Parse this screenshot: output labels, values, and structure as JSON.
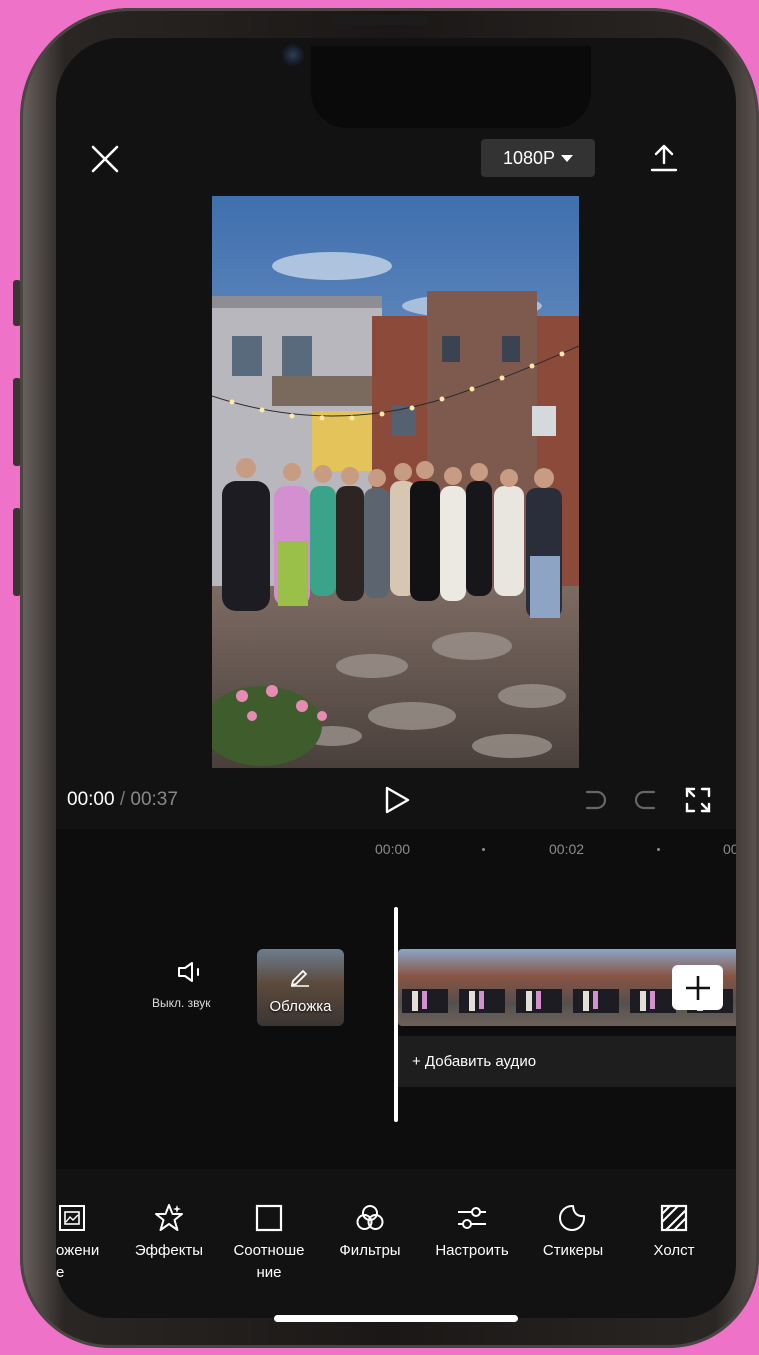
{
  "header": {
    "resolution_label": "1080P"
  },
  "player": {
    "current_time": "00:00",
    "separator": "/",
    "total_time": "00:37"
  },
  "ruler": {
    "marks": [
      "00:00",
      "00:02",
      "00"
    ]
  },
  "tracks": {
    "mute_label": "Выкл. звук",
    "cover_label": "Обложка",
    "add_audio_label": "+ Добавить аудио"
  },
  "toolbar": {
    "items": [
      {
        "label": "ожени\nе",
        "icon": "image-overlay-icon"
      },
      {
        "label": "Эффекты",
        "icon": "effects-star-icon"
      },
      {
        "label": "Соотноше\nние",
        "icon": "aspect-ratio-icon"
      },
      {
        "label": "Фильтры",
        "icon": "filters-icon"
      },
      {
        "label": "Настроить",
        "icon": "adjust-sliders-icon"
      },
      {
        "label": "Стикеры",
        "icon": "stickers-icon"
      },
      {
        "label": "Холст",
        "icon": "canvas-icon"
      }
    ]
  },
  "colors": {
    "background": "#ee72c8",
    "screen": "#121212",
    "timeline": "#0d0d0d",
    "accent": "#ffffff"
  }
}
